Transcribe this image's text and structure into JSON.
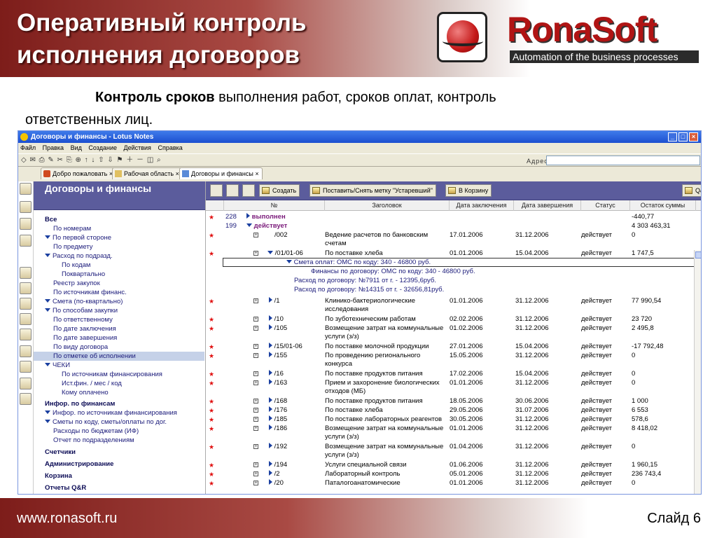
{
  "slide": {
    "title_line1": "Оперативный контроль",
    "title_line2": "исполнения договоров",
    "brand_name": "RonaSoft",
    "brand_tagline": "Automation of the business processes",
    "intro_bold": "Контроль сроков",
    "intro_rest1": " выполнения работ, сроков оплат, контроль",
    "intro_line2": "ответственных лиц.",
    "footer_url": "www.ronasoft.ru",
    "footer_slide": "Слайд 6"
  },
  "window": {
    "title": "Договоры и финансы - Lotus Notes",
    "menu": [
      "Файл",
      "Правка",
      "Вид",
      "Создание",
      "Действия",
      "Справка"
    ],
    "toolbar_glyphs": "◇ ✉ ⎙ ✎ ✂ ⎘ ⊕ ↑ ↓ ⇧ ⇩ ⚑ ＋ － ◫ ⌕",
    "address_label": "Адрес",
    "tabs": [
      "Добро пожаловать",
      "Рабочая область",
      "Договоры и финансы"
    ]
  },
  "nav": {
    "title": "Договоры и финансы",
    "items": [
      "Все",
      "По номерам",
      "По первой стороне",
      "По предмету",
      "Расход по подразд.",
      "По кодам",
      "Поквартально",
      "Реестр закупок",
      "По источникам финанс.",
      "Смета (по-квартально)",
      "По способам закупки",
      "По ответственному",
      "По дате заключения",
      "По дате завершения",
      "По виду договора",
      "По отметке об исполнении",
      "ЧЕКИ",
      "По источникам финансирования",
      "Ист.фин. / мес / код",
      "Кому оплачено",
      "Инфор. по финансам",
      "Инфор. по источникам финансирования",
      "Сметы по коду, сметы/оплаты по дог.",
      "Расходы по бюджетам (ИФ)",
      "Отчет по подразделениям",
      "Счетчики",
      "Администрирование",
      "Корзина",
      "Отчеты Q&R"
    ]
  },
  "actions": {
    "create": "Создать",
    "mark": "Поставить/Снять метку \"Устаревший\"",
    "trash": "В Корзину",
    "qr": "Q&R"
  },
  "columns": [
    "№",
    "Заголовок",
    "Дата заключения",
    "Дата завершения",
    "Статус",
    "Остаток суммы"
  ],
  "rows": [
    {
      "num": "228",
      "title": "выполнен",
      "date1": "",
      "date2": "",
      "status": "",
      "sum": "-440,77"
    },
    {
      "num": "199",
      "title": "действует",
      "date1": "",
      "date2": "",
      "status": "",
      "sum": "4 303 463,31"
    },
    {
      "num": "/002",
      "title": "Ведение расчетов по банковским счетам",
      "date1": "17.01.2006",
      "date2": "31.12.2006",
      "status": "действует",
      "sum": "0"
    },
    {
      "num": "/01/01-06",
      "title": "По поставке хлеба",
      "date1": "01.01.2006",
      "date2": "15.04.2006",
      "status": "действует",
      "sum": "1 747,5"
    },
    {
      "num": "",
      "title": "Смета оплат: ОМС по коду: 340 - 46800 руб.",
      "date1": "",
      "date2": "",
      "status": "",
      "sum": ""
    },
    {
      "num": "",
      "title": "Финансы по договору: ОМС по коду: 340 - 46800 руб.",
      "date1": "",
      "date2": "",
      "status": "",
      "sum": ""
    },
    {
      "num": "",
      "title": "Расход по договору: №7911 от г. - 12395,6руб.",
      "date1": "",
      "date2": "",
      "status": "",
      "sum": ""
    },
    {
      "num": "",
      "title": "Расход по договору: №14315 от г. - 32656,81руб.",
      "date1": "",
      "date2": "",
      "status": "",
      "sum": ""
    },
    {
      "num": "/1",
      "title": "Клинико-бактериологические исследования",
      "date1": "01.01.2006",
      "date2": "31.12.2006",
      "status": "действует",
      "sum": "77 990,54"
    },
    {
      "num": "/10",
      "title": "По зуботехническим работам",
      "date1": "02.02.2006",
      "date2": "31.12.2006",
      "status": "действует",
      "sum": "23 720"
    },
    {
      "num": "/105",
      "title": "Возмещение затрат на коммунальные услуги (з/з)",
      "date1": "01.02.2006",
      "date2": "31.12.2006",
      "status": "действует",
      "sum": "2 495,8"
    },
    {
      "num": "/15/01-06",
      "title": "По поставке молочной продукции",
      "date1": "27.01.2006",
      "date2": "15.04.2006",
      "status": "действует",
      "sum": "-17 792,48"
    },
    {
      "num": "/155",
      "title": "По проведению регионального конкурса",
      "date1": "15.05.2006",
      "date2": "31.12.2006",
      "status": "действует",
      "sum": "0"
    },
    {
      "num": "/16",
      "title": "По поставке продуктов питания",
      "date1": "17.02.2006",
      "date2": "15.04.2006",
      "status": "действует",
      "sum": "0"
    },
    {
      "num": "/163",
      "title": "Прием и захоронение биологических отходов (МБ)",
      "date1": "01.01.2006",
      "date2": "31.12.2006",
      "status": "действует",
      "sum": "0"
    },
    {
      "num": "/168",
      "title": "По поставке продуктов питания",
      "date1": "18.05.2006",
      "date2": "30.06.2006",
      "status": "действует",
      "sum": "1 000"
    },
    {
      "num": "/176",
      "title": "По поставке хлеба",
      "date1": "29.05.2006",
      "date2": "31.07.2006",
      "status": "действует",
      "sum": "6 553"
    },
    {
      "num": "/185",
      "title": "По поставке лабораторных реагентов",
      "date1": "30.05.2006",
      "date2": "31.12.2006",
      "status": "действует",
      "sum": "578,6"
    },
    {
      "num": "/186",
      "title": "Возмещение затрат на коммунальные услуги (з/з)",
      "date1": "01.01.2006",
      "date2": "31.12.2006",
      "status": "действует",
      "sum": "8 418,02"
    },
    {
      "num": "/192",
      "title": "Возмещение затрат на коммунальные услуги (з/з)",
      "date1": "01.04.2006",
      "date2": "31.12.2006",
      "status": "действует",
      "sum": "0"
    },
    {
      "num": "/194",
      "title": "Услуги специальной связи",
      "date1": "01.06.2006",
      "date2": "31.12.2006",
      "status": "действует",
      "sum": "1 960,15"
    },
    {
      "num": "/2",
      "title": "Лабораторный контроль",
      "date1": "05.01.2006",
      "date2": "31.12.2006",
      "status": "действует",
      "sum": "236 743,4"
    },
    {
      "num": "/20",
      "title": "Паталогоанатомические",
      "date1": "01.01.2006",
      "date2": "31.12.2006",
      "status": "действует",
      "sum": "0"
    }
  ],
  "colors": {
    "header_red": "#7d1d1a",
    "nav_header": "#5b5c9c",
    "brand_red": "#b01414",
    "star_red": "#e01010"
  }
}
